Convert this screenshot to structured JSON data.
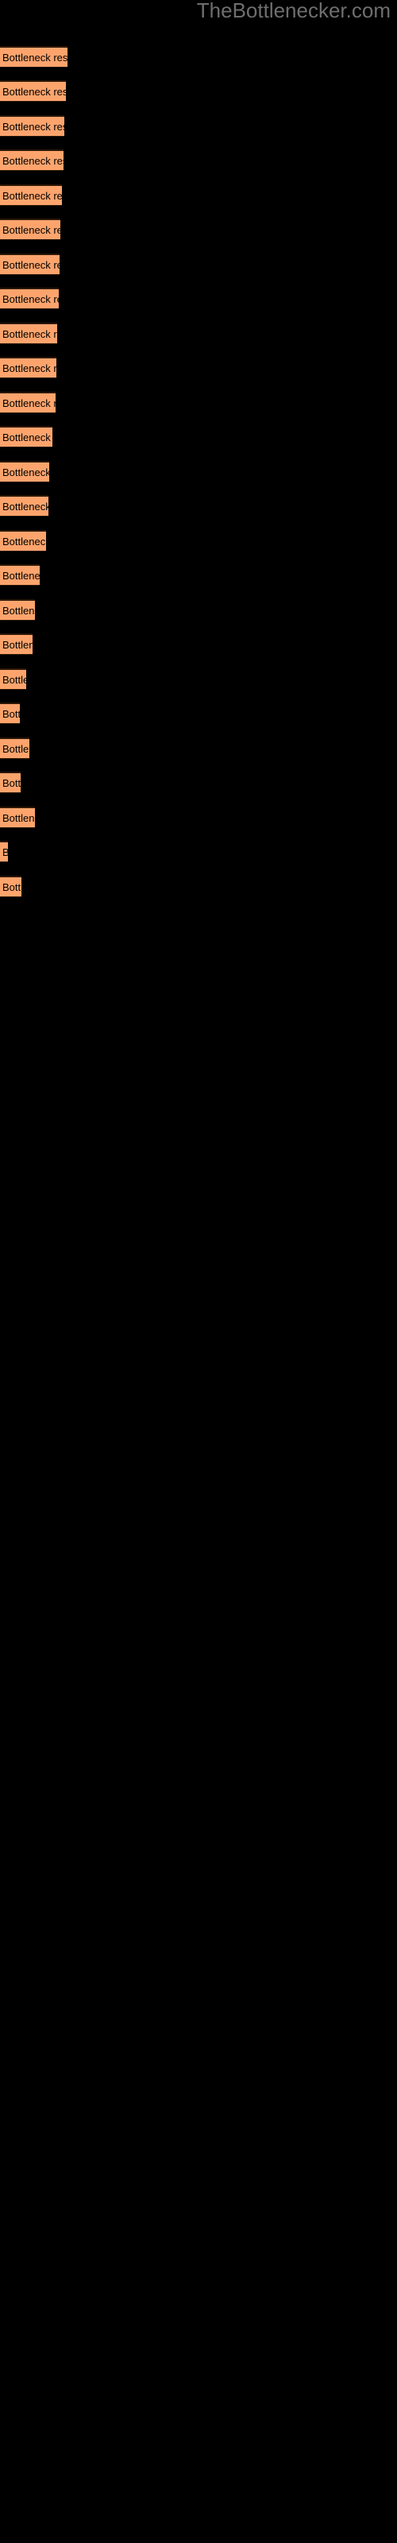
{
  "watermark": {
    "text": "TheBottlenecker.com",
    "color": "#6e6e6e"
  },
  "colors": {
    "background": "#000000",
    "bar_fill": "#fda46d",
    "bar_border": "#2b1708",
    "bar_label": "#000000"
  },
  "bar_label_text": "Bottleneck result",
  "chart_data": {
    "type": "bar",
    "orientation": "horizontal",
    "title": "",
    "subtitle": "",
    "xlabel": "",
    "ylabel": "",
    "grid": false,
    "legend": null,
    "annotations": [
      "TheBottlenecker.com"
    ],
    "axis_labels_visible": false,
    "tick_labels": [],
    "categories": [
      "Bottleneck result",
      "Bottleneck result",
      "Bottleneck result",
      "Bottleneck result",
      "Bottleneck result",
      "Bottleneck result",
      "Bottleneck result",
      "Bottleneck result",
      "Bottleneck result",
      "Bottleneck result",
      "Bottleneck result",
      "Bottleneck result",
      "Bottleneck result",
      "Bottleneck result",
      "Bottleneck result",
      "Bottleneck result",
      "Bottleneck result",
      "Bottleneck result",
      "Bottleneck result",
      "Bottleneck result",
      "Bottleneck result",
      "Bottleneck result",
      "Bottleneck result",
      "Bottleneck result"
    ],
    "values": [
      85,
      83,
      81,
      80,
      78,
      76,
      75,
      74,
      72,
      71,
      70,
      66,
      62,
      61,
      58,
      50,
      44,
      41,
      33,
      25,
      37,
      26,
      44,
      10,
      27
    ],
    "xlim": [
      0,
      500
    ],
    "ylim": null,
    "bars": [
      {
        "index": 1,
        "y": 58,
        "width": 85,
        "label": "Bottleneck result"
      },
      {
        "index": 2,
        "y": 101,
        "width": 83,
        "label": "Bottleneck result"
      },
      {
        "index": 3,
        "y": 145,
        "width": 81,
        "label": "Bottleneck result"
      },
      {
        "index": 4,
        "y": 188,
        "width": 80,
        "label": "Bottleneck result"
      },
      {
        "index": 5,
        "y": 232,
        "width": 78,
        "label": "Bottleneck result"
      },
      {
        "index": 6,
        "y": 275,
        "width": 76,
        "label": "Bottleneck result"
      },
      {
        "index": 7,
        "y": 319,
        "width": 75,
        "label": "Bottleneck result"
      },
      {
        "index": 8,
        "y": 362,
        "width": 74,
        "label": "Bottleneck result"
      },
      {
        "index": 9,
        "y": 406,
        "width": 72,
        "label": "Bottleneck result"
      },
      {
        "index": 10,
        "y": 449,
        "width": 71,
        "label": "Bottleneck result"
      },
      {
        "index": 11,
        "y": 493,
        "width": 70,
        "label": "Bottleneck result"
      },
      {
        "index": 12,
        "y": 536,
        "width": 66,
        "label": "Bottleneck result"
      },
      {
        "index": 13,
        "y": 580,
        "width": 62,
        "label": "Bottleneck result"
      },
      {
        "index": 14,
        "y": 623,
        "width": 61,
        "label": "Bottleneck result"
      },
      {
        "index": 15,
        "y": 667,
        "width": 58,
        "label": "Bottleneck result"
      },
      {
        "index": 16,
        "y": 710,
        "width": 50,
        "label": "Bottleneck result"
      },
      {
        "index": 17,
        "y": 754,
        "width": 44,
        "label": "Bottleneck result"
      },
      {
        "index": 18,
        "y": 797,
        "width": 41,
        "label": "Bottleneck result"
      },
      {
        "index": 19,
        "y": 841,
        "width": 33,
        "label": "Bottleneck result"
      },
      {
        "index": 20,
        "y": 884,
        "width": 25,
        "label": "Bottleneck result"
      },
      {
        "index": 21,
        "y": 928,
        "width": 37,
        "label": "Bottleneck result"
      },
      {
        "index": 22,
        "y": 971,
        "width": 26,
        "label": "Bottleneck result"
      },
      {
        "index": 23,
        "y": 1015,
        "width": 44,
        "label": "Bottleneck result"
      },
      {
        "index": 24,
        "y": 1058,
        "width": 10,
        "label": "Bottleneck result"
      },
      {
        "index": 25,
        "y": 1102,
        "width": 27,
        "label": "Bottleneck result"
      }
    ]
  }
}
